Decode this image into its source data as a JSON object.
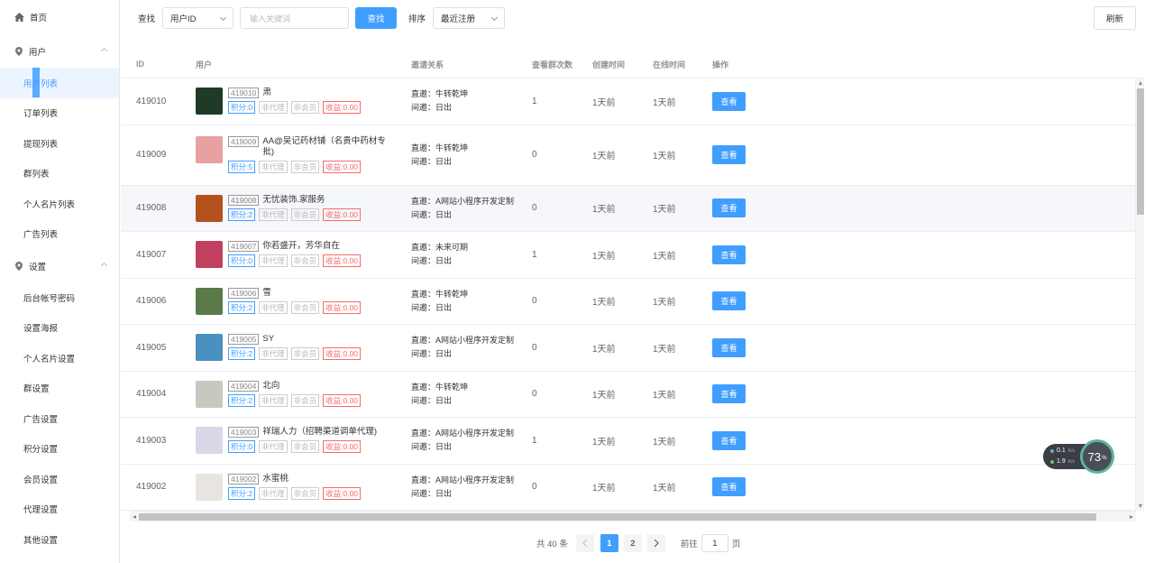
{
  "sidebar": {
    "home": "首页",
    "group_users": "用户",
    "users_items": [
      "用户列表",
      "订单列表",
      "提现列表",
      "群列表",
      "个人名片列表",
      "广告列表"
    ],
    "group_settings": "设置",
    "settings_items": [
      "后台帐号密码",
      "设置海报",
      "个人名片设置",
      "群设置",
      "广告设置",
      "积分设置",
      "会员设置",
      "代理设置",
      "其他设置"
    ]
  },
  "toolbar": {
    "find_label": "查找",
    "field_select": "用户ID",
    "keyword_placeholder": "输入关键词",
    "search_btn": "查找",
    "sort_label": "排序",
    "sort_select": "最近注册",
    "refresh_btn": "刷新"
  },
  "table": {
    "headers": [
      "ID",
      "用户",
      "邀请关系",
      "查看群次数",
      "创建时间",
      "在线时间",
      "操作"
    ],
    "view_label": "查看",
    "tag_non_agent": "非代理",
    "tag_non_member": "非会员",
    "rows": [
      {
        "id": "419010",
        "name": "肃",
        "points": "积分:0",
        "income": "收益:0.00",
        "direct": "直邀：牛转乾坤",
        "indirect": "间邀：日出",
        "views": "1",
        "created": "1天前",
        "online": "1天前"
      },
      {
        "id": "419009",
        "name": "AA@吴记药材铺（名贵中药材专批)",
        "points": "积分:5",
        "income": "收益:0.00",
        "direct": "直邀：牛转乾坤",
        "indirect": "间邀：日出",
        "views": "0",
        "created": "1天前",
        "online": "1天前"
      },
      {
        "id": "419008",
        "name": "无忧装饰.家服务",
        "points": "积分:2",
        "income": "收益:0.00",
        "direct": "直邀：A网站小程序开发定制",
        "indirect": "间邀：日出",
        "views": "0",
        "created": "1天前",
        "online": "1天前"
      },
      {
        "id": "419007",
        "name": "你若盛开，芳华自在",
        "points": "积分:0",
        "income": "收益:0.00",
        "direct": "直邀：未来可期",
        "indirect": "间邀：日出",
        "views": "1",
        "created": "1天前",
        "online": "1天前"
      },
      {
        "id": "419006",
        "name": "雪",
        "points": "积分:2",
        "income": "收益:0.00",
        "direct": "直邀：牛转乾坤",
        "indirect": "间邀：日出",
        "views": "0",
        "created": "1天前",
        "online": "1天前"
      },
      {
        "id": "419005",
        "name": "SY",
        "points": "积分:2",
        "income": "收益:0.00",
        "direct": "直邀：A网站小程序开发定制",
        "indirect": "间邀：日出",
        "views": "0",
        "created": "1天前",
        "online": "1天前"
      },
      {
        "id": "419004",
        "name": "北向",
        "points": "积分:2",
        "income": "收益:0.00",
        "direct": "直邀：牛转乾坤",
        "indirect": "间邀：日出",
        "views": "0",
        "created": "1天前",
        "online": "1天前"
      },
      {
        "id": "419003",
        "name": "祥瑞人力（招聘渠道调单代理)",
        "points": "积分:0",
        "income": "收益:0.00",
        "direct": "直邀：A网站小程序开发定制",
        "indirect": "间邀：日出",
        "views": "1",
        "created": "1天前",
        "online": "1天前"
      },
      {
        "id": "419002",
        "name": "水蜜桃",
        "points": "积分:2",
        "income": "收益:0.00",
        "direct": "直邀：A网站小程序开发定制",
        "indirect": "间邀：日出",
        "views": "0",
        "created": "1天前",
        "online": "1天前"
      }
    ],
    "avatar_colors": [
      "#1f3a26",
      "#e8a0a0",
      "#b5501f",
      "#c04060",
      "#5a7a4a",
      "#4a90c0",
      "#c8c8c0",
      "#d8d8e8",
      "#e8e4e0"
    ]
  },
  "pagination": {
    "total": "共 40 条",
    "pages": [
      "1",
      "2"
    ],
    "goto_prefix": "前往",
    "goto_value": "1",
    "goto_suffix": "页"
  },
  "net_widget": {
    "up": "0.1",
    "down": "1.9",
    "unit": "K/s",
    "percent": "73",
    "percent_sign": "%"
  },
  "colors": {
    "primary": "#409eff",
    "danger": "#f56c6c"
  }
}
